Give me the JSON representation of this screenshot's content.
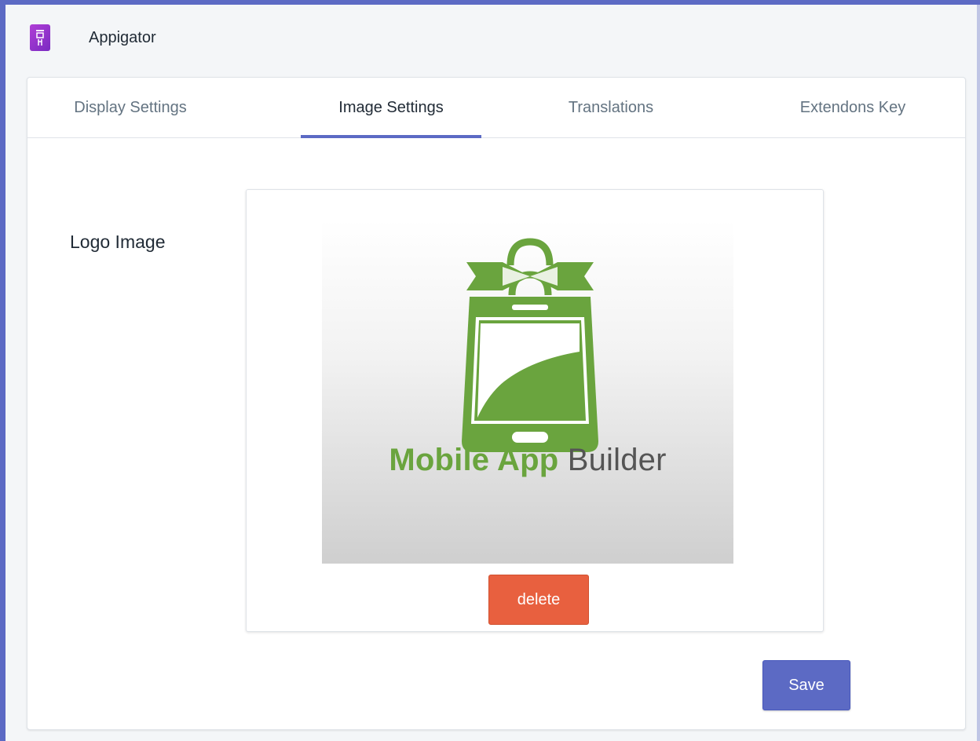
{
  "app": {
    "name": "Appigator",
    "icon": "app-logo-icon"
  },
  "tabs": [
    {
      "label": "Display Settings",
      "active": false
    },
    {
      "label": "Image Settings",
      "active": true
    },
    {
      "label": "Translations",
      "active": false
    },
    {
      "label": "Extendons Key",
      "active": false
    }
  ],
  "logo_section": {
    "label": "Logo Image",
    "image": {
      "brand_word_1": "Mobile App",
      "brand_word_2": "Builder",
      "icon": "shopping-bag-phone-icon"
    },
    "delete_label": "delete"
  },
  "actions": {
    "save_label": "Save"
  },
  "colors": {
    "accent": "#5c6ac4",
    "delete": "#e8603f",
    "brand_green": "#6aa43e"
  }
}
